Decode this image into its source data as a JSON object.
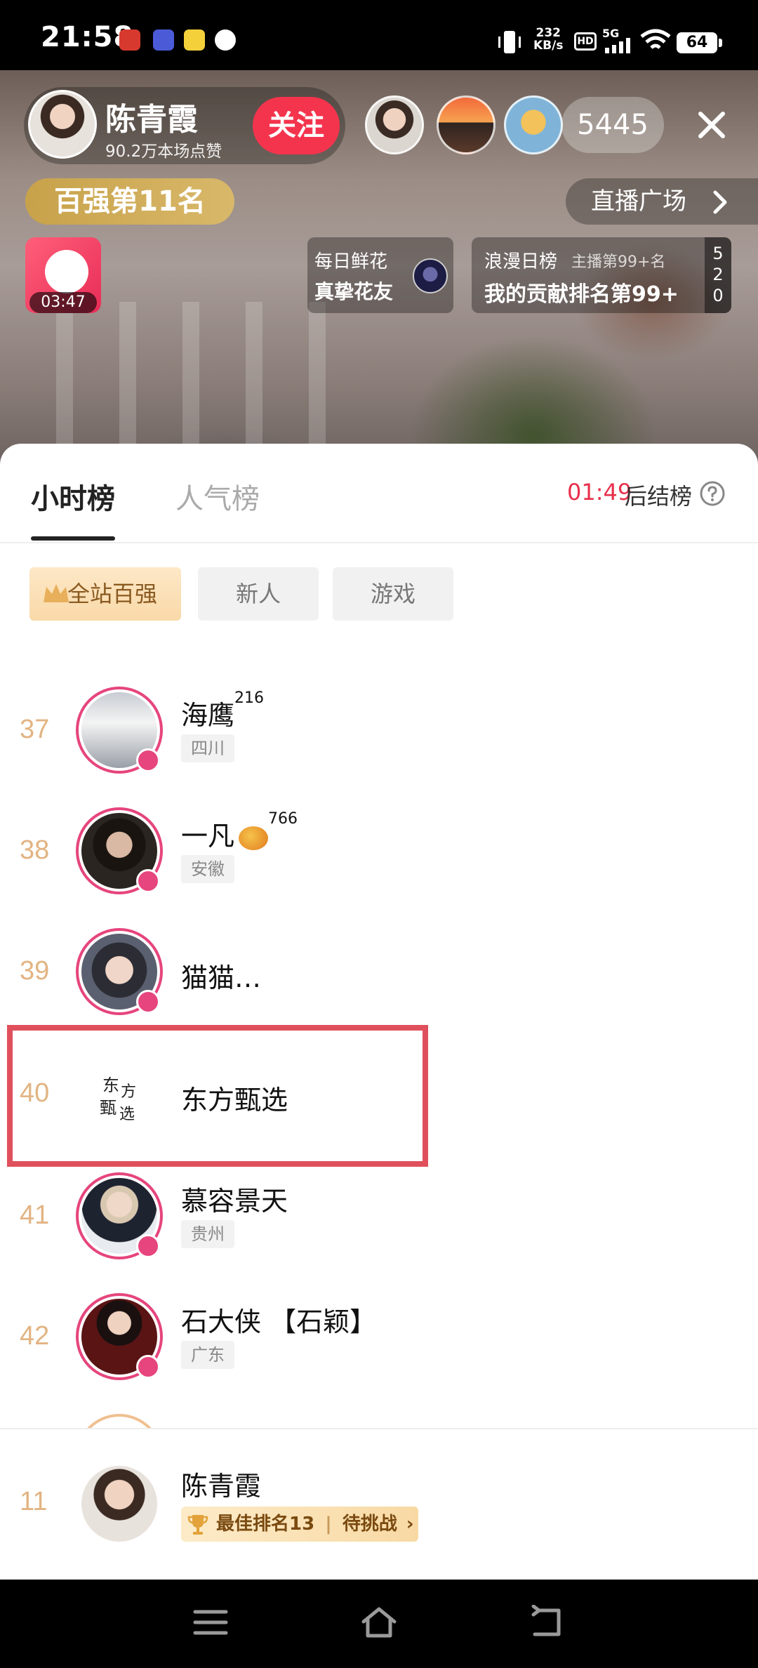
{
  "status_bar": {
    "time": "21:58",
    "net_speed_value": "232",
    "net_speed_unit": "KB/s",
    "hd_label": "HD",
    "network": "5G",
    "battery": "64"
  },
  "live_header": {
    "host_name": "陈青霞",
    "host_likes": "90.2万本场点赞",
    "follow_label": "关注",
    "viewer_count": "5445",
    "rank_badge": "百强第11名",
    "plaza_label": "直播广场",
    "gift_time": "03:47",
    "flower_title": "每日鲜花",
    "flower_subtitle": "真挚花友",
    "romance_title": "浪漫日榜",
    "romance_tag": "主播第99+名",
    "romance_rank": "我的贡献排名第99+",
    "romance_side": [
      "5",
      "2",
      "0"
    ]
  },
  "ranking": {
    "tabs": [
      {
        "label": "小时榜",
        "active": true
      },
      {
        "label": "人气榜",
        "active": false
      }
    ],
    "countdown_time": "01:49",
    "countdown_label": "后结榜",
    "filters": [
      "全站百强",
      "新人",
      "游戏"
    ],
    "rows": [
      {
        "rank": "37",
        "name": "海鹰",
        "sup": "216",
        "region": "四川"
      },
      {
        "rank": "38",
        "name": "一凡",
        "sup": "766",
        "region": "安徽"
      },
      {
        "rank": "39",
        "name": "猫猫…",
        "sup": "",
        "region": ""
      },
      {
        "rank": "40",
        "name": "东方甄选",
        "sup": "",
        "region": ""
      },
      {
        "rank": "41",
        "name": "慕容景天",
        "sup": "",
        "region": "贵州"
      },
      {
        "rank": "42",
        "name": "石大侠 【石颖】",
        "sup": "",
        "region": "广东"
      }
    ],
    "logo_text": "东方甄选",
    "self": {
      "rank": "11",
      "name": "陈青霞",
      "best_rank": "最佳排名13",
      "challenge": "待挑战"
    }
  },
  "colors": {
    "accent_red": "#f4344d",
    "rank_gold": "#e2b483",
    "ring_pink": "#e6457d",
    "highlight": "#e0505c"
  },
  "icons": [
    "close-icon",
    "chevron-right-icon",
    "crown-icon",
    "help-icon",
    "trophy-icon",
    "menu-icon",
    "home-icon",
    "back-icon"
  ]
}
